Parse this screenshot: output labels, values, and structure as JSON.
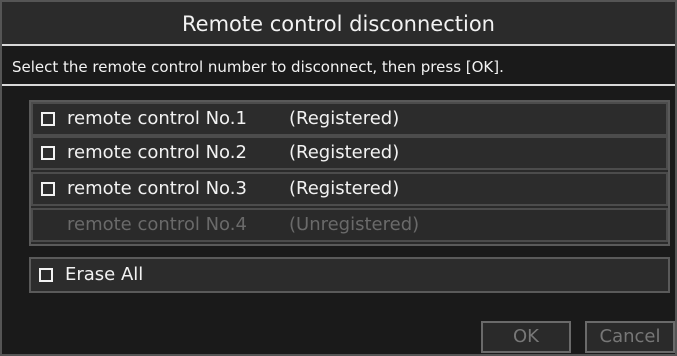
{
  "dialog": {
    "title": "Remote control disconnection",
    "instruction": "Select the remote control number to disconnect, then press [OK]."
  },
  "remotes": [
    {
      "label": "remote control No.1",
      "status": "(Registered)",
      "enabled": true,
      "checked": false
    },
    {
      "label": "remote control No.2",
      "status": "(Registered)",
      "enabled": true,
      "checked": false
    },
    {
      "label": "remote control No.3",
      "status": "(Registered)",
      "enabled": true,
      "checked": false
    },
    {
      "label": "remote control No.4",
      "status": "(Unregistered)",
      "enabled": false,
      "checked": false
    }
  ],
  "erase_all": {
    "label": "Erase All",
    "checked": false
  },
  "buttons": {
    "ok": "OK",
    "cancel": "Cancel"
  }
}
